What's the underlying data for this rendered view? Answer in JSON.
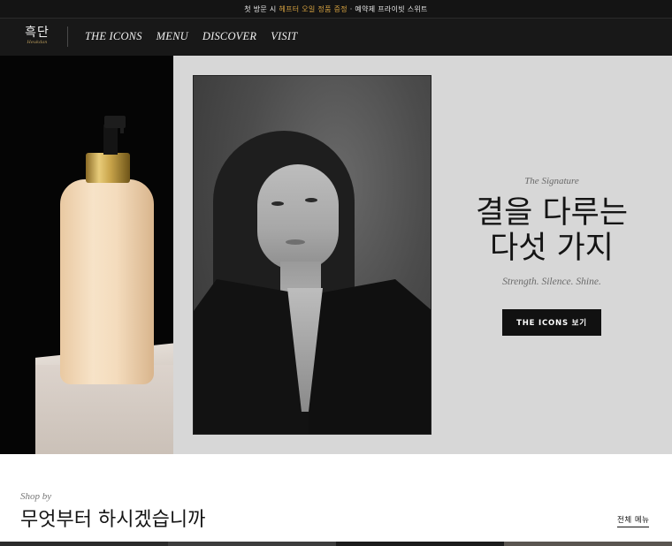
{
  "announcement": {
    "prefix": "첫 방문 시",
    "highlight": "헤프터 오일 정품 증정",
    "suffix": "· 예약제 프라이빗 스위트",
    "highlight_color": "#d9a441"
  },
  "header": {
    "logo_ko": "흑단",
    "logo_en": "Heukdan",
    "nav": [
      "THE ICONS",
      "MENU",
      "DISCOVER",
      "VISIT"
    ]
  },
  "hero": {
    "eyebrow": "The Signature",
    "title_line1": "결을 다루는",
    "title_line2": "다섯 가지",
    "subtitle": "Strength. Silence. Shine.",
    "cta": "THE ICONS 보기"
  },
  "shop": {
    "eyebrow": "Shop by",
    "title": "무엇부터 하시겠습니까",
    "all_link": "전체 메뉴"
  },
  "colors": {
    "bar_bg": "#141414",
    "header_bg": "#181818",
    "hero_bg": "#d7d7d7",
    "cta_bg": "#111111"
  }
}
